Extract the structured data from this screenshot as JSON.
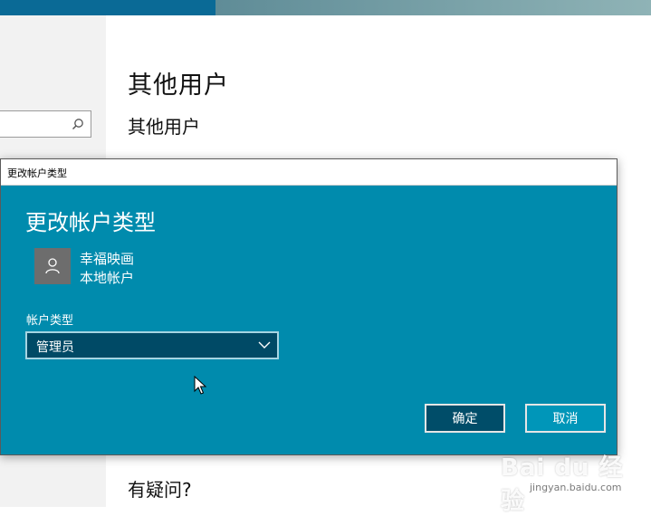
{
  "settings": {
    "page_title": "其他用户",
    "section_title": "其他用户",
    "bottom_title": "有疑问?"
  },
  "dialog": {
    "window_title": "更改帐户类型",
    "heading": "更改帐户类型",
    "user": {
      "name": "幸福映画",
      "account_kind": "本地帐户"
    },
    "account_type_label": "帐户类型",
    "account_type_value": "管理员",
    "ok_label": "确定",
    "cancel_label": "取消"
  },
  "watermark": {
    "brand": "Bai du 经验",
    "url": "jingyan.baidu.com"
  },
  "colors": {
    "dialog_bg": "#008bad",
    "select_bg": "#004a66",
    "ok_button_bg": "#004d69",
    "avatar_bg": "#6d6d6d"
  },
  "icons": {
    "search": "search-icon",
    "avatar": "person-icon",
    "dropdown": "chevron-down-icon",
    "cursor": "mouse-pointer-icon"
  }
}
